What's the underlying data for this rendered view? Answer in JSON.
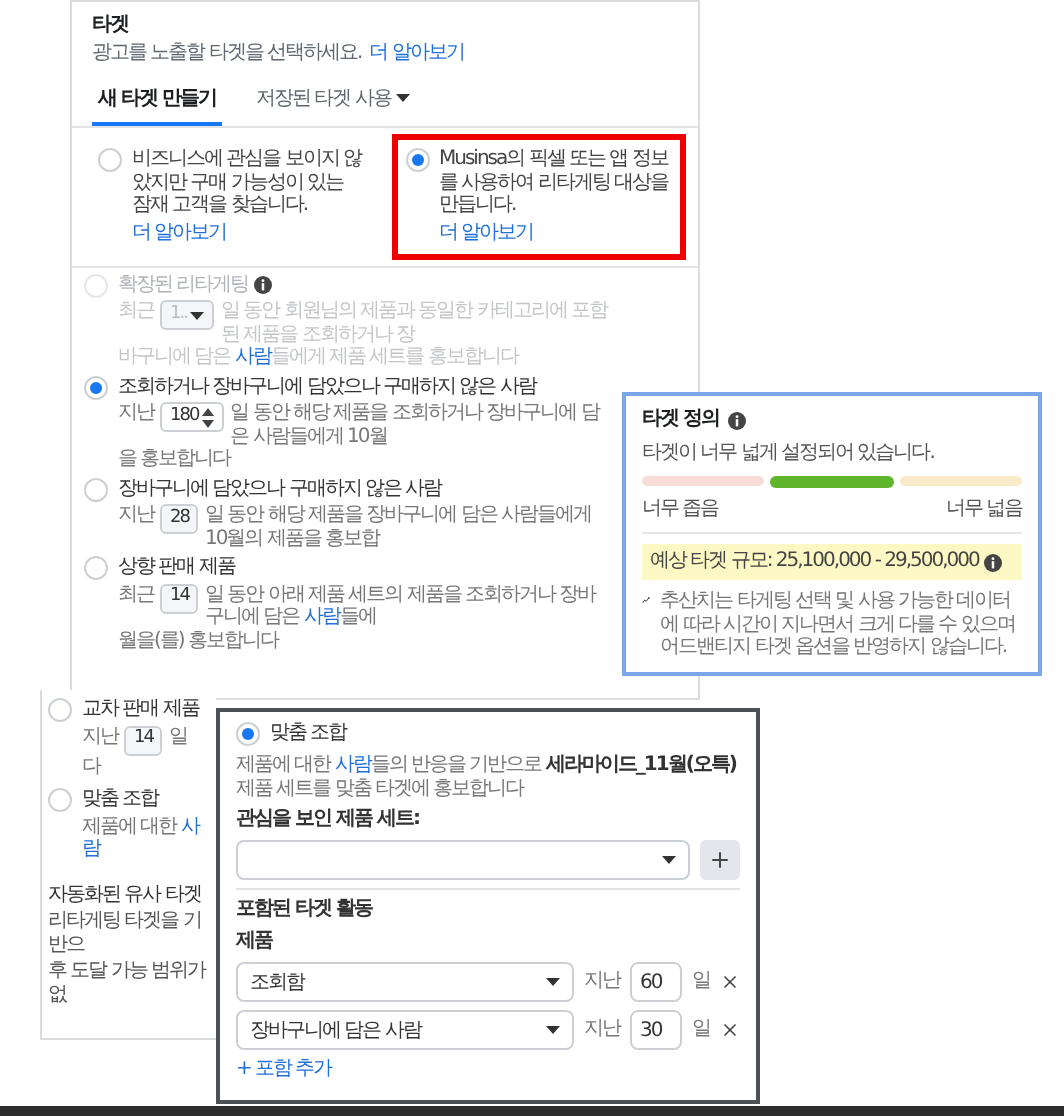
{
  "targeting_panel": {
    "title": "타겟",
    "subtitle": "광고를 노출할 타겟을 선택하세요.",
    "subtitle_link": "더 알아보기",
    "tabs": [
      {
        "label": "새 타겟 만들기",
        "selected": true,
        "dropdown": false
      },
      {
        "label": "저장된 타겟 사용",
        "selected": false,
        "dropdown": true
      }
    ],
    "options": [
      {
        "text": "비즈니스에 관심을 보이지 않았지만 구매 가능성이 있는 잠재 고객을 찾습니다.",
        "link": "더 알아보기",
        "selected": false,
        "highlighted": false
      },
      {
        "text": "Musinsa의 픽셀 또는 앱 정보를 사용하여 리타게팅 대상을 만듭니다.",
        "link": "더 알아보기",
        "selected": true,
        "highlighted": true
      }
    ],
    "retargeting_options": [
      {
        "label": "확장된 리타게팅",
        "info": true,
        "disabled": true,
        "selected": false,
        "prefix": "최근",
        "value": "1..",
        "kind": "dropdown",
        "lines": [
          [
            {
              "text": "일 동안 회원님의 제품과 동일한 카테고리에 포함된 제품을 조회하거나 장",
              "kind": "plain"
            }
          ],
          [
            {
              "text": "바구니에 담은 ",
              "kind": "plain"
            },
            {
              "text": "사람",
              "kind": "link"
            },
            {
              "text": "들에게 제품 세트를 홍보합니다",
              "kind": "plain"
            }
          ]
        ]
      },
      {
        "label": "조회하거나 장바구니에 담았으나 구매하지 않은 사람",
        "info": false,
        "disabled": false,
        "selected": true,
        "prefix": "지난",
        "value": "180",
        "kind": "spinner",
        "lines": [
          [
            {
              "text": "일 동안 해당 제품을 조회하거나 장바구니에 담은 사람들에게 10월",
              "kind": "plain"
            }
          ],
          [
            {
              "text": "을 홍보합니다",
              "kind": "plain"
            }
          ]
        ]
      },
      {
        "label": "장바구니에 담았으나 구매하지 않은 사람",
        "info": false,
        "disabled": false,
        "selected": false,
        "prefix": "지난",
        "value": "28",
        "kind": "input",
        "lines": [
          [
            {
              "text": "일 동안 해당 제품을 장바구니에 담은 사람들에게 10월의 제품을 홍보합",
              "kind": "plain"
            }
          ]
        ]
      },
      {
        "label": "상향 판매 제품",
        "info": false,
        "disabled": false,
        "selected": false,
        "prefix": "최근",
        "value": "14",
        "kind": "input",
        "lines": [
          [
            {
              "text": "일 동안 아래 제품 세트의 제품을 조회하거나 장바구니에 담은 ",
              "kind": "plain"
            },
            {
              "text": "사람",
              "kind": "link"
            },
            {
              "text": "들에",
              "kind": "plain"
            }
          ],
          [
            {
              "text": "월을(를) 홍보합니다",
              "kind": "plain"
            }
          ]
        ]
      }
    ]
  },
  "more_options_panel": {
    "options": [
      {
        "label": "교차 판매 제품",
        "selected": false,
        "prefix": "지난",
        "value": "14",
        "kind": "input",
        "lines": [
          [
            {
              "text": "일",
              "kind": "plain"
            }
          ],
          [
            {
              "text": "다",
              "kind": "plain"
            }
          ]
        ]
      },
      {
        "label": "맞춤 조합",
        "selected": false,
        "lines": [
          [
            {
              "text": "제품에 대한 ",
              "kind": "plain"
            },
            {
              "text": "사람",
              "kind": "link"
            }
          ]
        ]
      }
    ],
    "lookalike": {
      "title": "자동화된 유사 타겟",
      "lines": [
        "리타게팅 타겟을 기반으",
        "후 도달 가능 범위가 없"
      ]
    }
  },
  "audience_definition": {
    "title": "타겟 정의",
    "status": "타겟이 너무 넓게 설정되어 있습니다.",
    "segments": [
      {
        "color": "#f8dcd7",
        "selected": false
      },
      {
        "color": "#5fb52b",
        "selected": true
      },
      {
        "color": "#f9ebca",
        "selected": false
      }
    ],
    "min_label": "너무 좁음",
    "max_label": "너무 넓음",
    "estimate": "예상 타겟 규모: 25,100,000 - 29,500,000",
    "note": "추산치는 타게팅 선택 및 사용 가능한 데이터에 따라 시간이 지나면서 크게 다를 수 있으며 어드밴티지 타겟 옵션을 반영하지 않습니다."
  },
  "custom_combination": {
    "label": "맞춤 조합",
    "selected": true,
    "description": [
      {
        "text": "제품에 대한 ",
        "kind": "plain"
      },
      {
        "text": "사람",
        "kind": "link"
      },
      {
        "text": "들의 반응을 기반으로 ",
        "kind": "plain"
      },
      {
        "text": "세라마이드_11월(오특)",
        "kind": "bold"
      },
      {
        "text": " 제품 세트를 맞춤 타겟에 홍보합니다",
        "kind": "plain"
      }
    ],
    "product_set_label": "관심을 보인 제품 세트:",
    "included_title": "포함된 타겟 활동",
    "products_label": "제품",
    "rules": [
      {
        "event": "조회함",
        "prefix": "지난",
        "days": "60",
        "unit": "일"
      },
      {
        "event": "장바구니에 담은 사람",
        "prefix": "지난",
        "days": "30",
        "unit": "일"
      }
    ],
    "add_link": "+ 포함 추가"
  }
}
